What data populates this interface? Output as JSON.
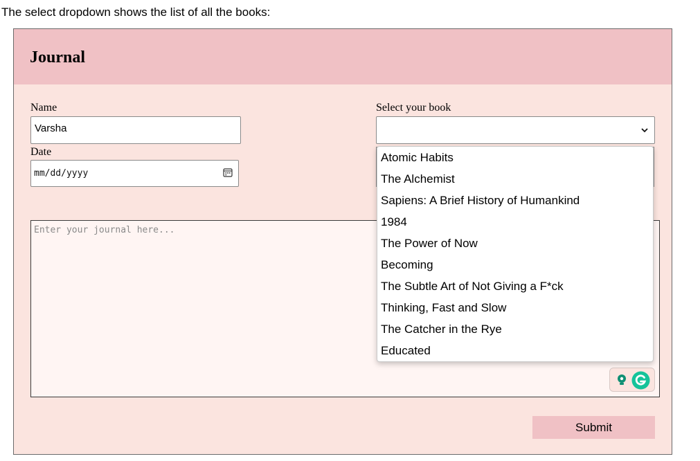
{
  "caption": "The select dropdown shows the list of all the books:",
  "app": {
    "title": "Journal",
    "form": {
      "name_label": "Name",
      "name_value": "Varsha",
      "date_label": "Date",
      "date_placeholder": "mm/dd/yyyy",
      "book_label": "Select your book",
      "book_selected": "",
      "journal_placeholder": "Enter your journal here...",
      "submit_label": "Submit"
    },
    "dropdown_options": [
      "Atomic Habits",
      "The Alchemist",
      "Sapiens: A Brief History of Humankind",
      "1984",
      "The Power of Now",
      "Becoming",
      "The Subtle Art of Not Giving a F*ck",
      "Thinking, Fast and Slow",
      "The Catcher in the Rye",
      "Educated"
    ]
  },
  "icons": {
    "calendar": "calendar-icon",
    "chevron": "chevron-down-icon",
    "grammarly_suggest": "lightbulb-icon",
    "grammarly_logo": "grammarly-logo-icon"
  },
  "colors": {
    "header": "#f0c1c5",
    "panel": "#fbe4df",
    "submit": "#f0c1c5",
    "grammarly": "#15c39a"
  }
}
